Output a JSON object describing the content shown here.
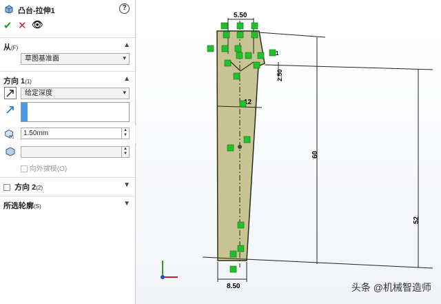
{
  "panel": {
    "title": "凸台-拉伸1",
    "help_label": "?",
    "actions": {
      "ok": "✔",
      "cancel": "✕",
      "preview": "👁"
    },
    "from": {
      "header": "从",
      "header_key": "(F)",
      "value": "草图基准面"
    },
    "direction1": {
      "header": "方向 1",
      "header_key": "(1)",
      "end_condition": "给定深度",
      "depth": "1.50mm",
      "draft_label": "向外拔模(O)"
    },
    "direction2": {
      "header": "方向 2",
      "header_key": "(2)"
    },
    "contours": {
      "header": "所选轮廓",
      "header_key": "(S)"
    }
  },
  "sketch": {
    "dim_top_width": "5.50",
    "dim_height_small": "2.50",
    "dim_mid_width": "12",
    "dim_total_height": "60",
    "dim_lower_height": "52",
    "dim_bottom_width": "8.50",
    "relation_label": "1"
  },
  "watermark": "头条 @机械智造师",
  "colors": {
    "part_fill": "#c8c494",
    "relation_green": "#22c02a",
    "accent_blue": "#1e7fd8"
  }
}
